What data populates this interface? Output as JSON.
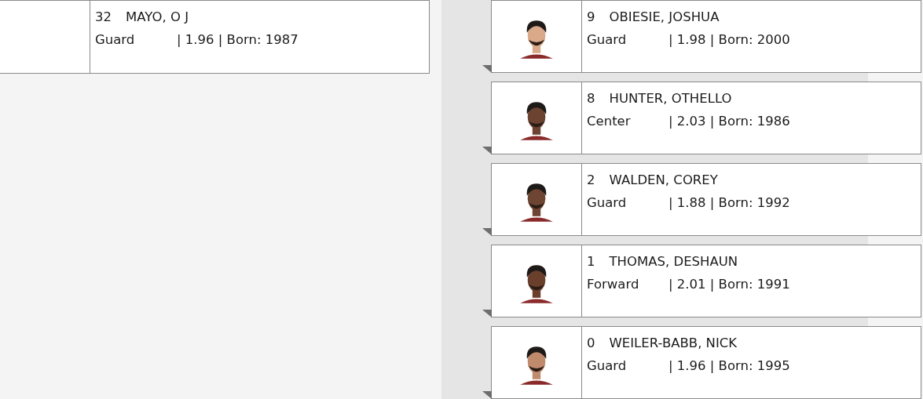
{
  "left_roster": [
    {
      "number": "32",
      "name": "MAYO, O J",
      "position": "Guard",
      "details": "| 1.96 | Born: 1987",
      "photo": false
    }
  ],
  "right_roster": [
    {
      "number": "9",
      "name": "OBIESIE, JOSHUA",
      "position": "Guard",
      "details": "| 1.98 | Born: 2000",
      "photo": true
    },
    {
      "number": "8",
      "name": "HUNTER, OTHELLO",
      "position": "Center",
      "details": "| 2.03 | Born: 1986",
      "photo": true
    },
    {
      "number": "2",
      "name": "WALDEN, COREY",
      "position": "Guard",
      "details": "| 1.88 | Born: 1992",
      "photo": true
    },
    {
      "number": "1",
      "name": "THOMAS, DESHAUN",
      "position": "Forward",
      "details": "| 2.01 | Born: 1991",
      "photo": true
    },
    {
      "number": "0",
      "name": "WEILER-BABB, NICK",
      "position": "Guard",
      "details": "| 1.96 | Born: 1995",
      "photo": true
    }
  ]
}
